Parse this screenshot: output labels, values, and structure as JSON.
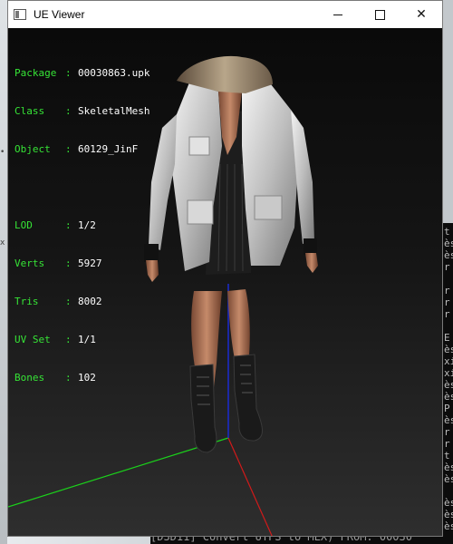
{
  "window": {
    "title": "UE Viewer",
    "minimize_label": "",
    "maximize_label": "",
    "close_label": "✕"
  },
  "icons": {
    "app": "ue-viewer-app-icon",
    "minimize": "minimize-icon",
    "maximize": "maximize-icon",
    "close": "close-icon"
  },
  "colors": {
    "label_green": "#36e436",
    "value_white": "#ffffff",
    "viewport_bg": "#121212",
    "axis_x": "#d11a1a",
    "axis_y": "#1bd11b",
    "axis_z": "#1a2bd1"
  },
  "mesh_info": [
    {
      "key": "Package",
      "value": "00030863.upk"
    },
    {
      "key": "Class",
      "value": "SkeletalMesh"
    },
    {
      "key": "Object",
      "value": "60129_JinF"
    }
  ],
  "lod_info": [
    {
      "key": "LOD",
      "value": "1/2"
    },
    {
      "key": "Verts",
      "value": "5927"
    },
    {
      "key": "Tris",
      "value": "8002"
    },
    {
      "key": "UV Set",
      "value": "1/1"
    },
    {
      "key": "Bones",
      "value": "102"
    }
  ],
  "background": {
    "console_lines": [
      "t",
      "ès",
      "ès",
      "r",
      "",
      "r",
      "r",
      "r",
      "",
      "E",
      "ès",
      "xi",
      "xi",
      "ès",
      "ès",
      "P",
      "ès",
      "r",
      "r",
      "t",
      "ès",
      "ès",
      "",
      "ès",
      "ès",
      "ès"
    ],
    "bottom_console_text": "[D3D11] Convert UTFS to MLX) FROM: 00030",
    "left_markers": [
      "•",
      "x"
    ]
  }
}
